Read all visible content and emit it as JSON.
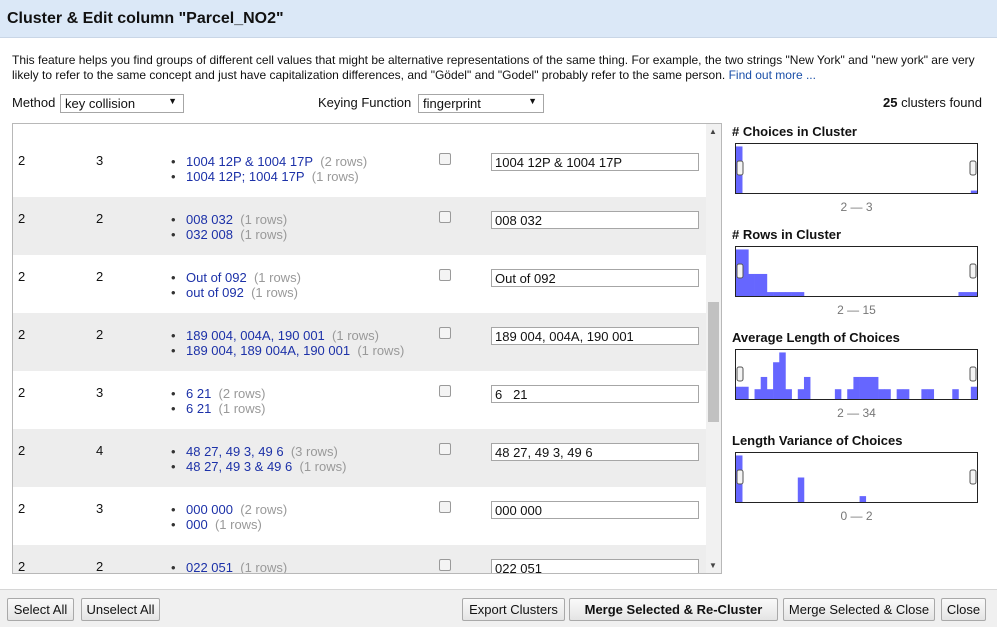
{
  "dialog": {
    "title": "Cluster & Edit column \"Parcel_NO2\"",
    "intro": "This feature helps you find groups of different cell values that might be alternative representations of the same thing. For example, the two strings \"New York\" and \"new york\" are very likely to refer to the same concept and just have capitalization differences, and \"Gödel\" and \"Godel\" probably refer to the same person.",
    "find_out_more": "Find out more ..."
  },
  "controls": {
    "method_label": "Method",
    "method_value": "key collision",
    "keying_label": "Keying Function",
    "keying_value": "fingerprint",
    "clusters_count": "25",
    "clusters_suffix": "clusters found"
  },
  "clusters": [
    {
      "size": "2",
      "rows": "3",
      "choices": [
        {
          "value": "1004 12P & 1004 17P",
          "count": "(2 rows)"
        },
        {
          "value": "1004 12P; 1004 17P",
          "count": "(1 rows)"
        }
      ],
      "new_value": "1004 12P & 1004 17P"
    },
    {
      "size": "2",
      "rows": "2",
      "choices": [
        {
          "value": "008 032",
          "count": "(1 rows)"
        },
        {
          "value": "032 008",
          "count": "(1 rows)"
        }
      ],
      "new_value": "008 032"
    },
    {
      "size": "2",
      "rows": "2",
      "choices": [
        {
          "value": "Out of 092",
          "count": "(1 rows)"
        },
        {
          "value": "out of 092",
          "count": "(1 rows)"
        }
      ],
      "new_value": "Out of 092"
    },
    {
      "size": "2",
      "rows": "2",
      "choices": [
        {
          "value": "189 004, 004A, 190 001",
          "count": "(1 rows)"
        },
        {
          "value": "189 004, 189 004A, 190 001",
          "count": "(1 rows)"
        }
      ],
      "new_value": "189 004, 004A, 190 001"
    },
    {
      "size": "2",
      "rows": "3",
      "choices": [
        {
          "value": "6 21",
          "count": "(2 rows)"
        },
        {
          "value": "6 21",
          "count": "(1 rows)"
        }
      ],
      "new_value": "6   21"
    },
    {
      "size": "2",
      "rows": "4",
      "choices": [
        {
          "value": "48 27, 49 3, 49 6",
          "count": "(3 rows)"
        },
        {
          "value": "48 27, 49 3 & 49 6",
          "count": "(1 rows)"
        }
      ],
      "new_value": "48 27, 49 3, 49 6"
    },
    {
      "size": "2",
      "rows": "3",
      "choices": [
        {
          "value": "000 000",
          "count": "(2 rows)"
        },
        {
          "value": "000",
          "count": "(1 rows)"
        }
      ],
      "new_value": "000 000"
    },
    {
      "size": "2",
      "rows": "2",
      "choices": [
        {
          "value": "022 051",
          "count": "(1 rows)"
        }
      ],
      "new_value": "022 051"
    }
  ],
  "facets": [
    {
      "title": "# Choices in Cluster",
      "range": "2 — 3",
      "bars": [
        0.95,
        0,
        0,
        0,
        0,
        0,
        0,
        0,
        0,
        0,
        0,
        0,
        0,
        0,
        0,
        0,
        0,
        0,
        0,
        0,
        0,
        0,
        0,
        0,
        0,
        0,
        0,
        0,
        0,
        0,
        0,
        0,
        0,
        0,
        0,
        0,
        0,
        0,
        0.05
      ]
    },
    {
      "title": "# Rows in Cluster",
      "range": "2 — 15",
      "bars": [
        0.95,
        0.95,
        0.45,
        0.45,
        0.45,
        0.08,
        0.08,
        0.08,
        0.08,
        0.08,
        0.08,
        0,
        0,
        0,
        0,
        0,
        0,
        0,
        0,
        0,
        0,
        0,
        0,
        0,
        0,
        0,
        0,
        0,
        0,
        0,
        0,
        0,
        0,
        0,
        0,
        0,
        0.08,
        0.08,
        0.08
      ]
    },
    {
      "title": "Average Length of Choices",
      "range": "2 — 34",
      "bars": [
        0.25,
        0.25,
        0,
        0.2,
        0.45,
        0.2,
        0.75,
        0.95,
        0.2,
        0,
        0.2,
        0.45,
        0,
        0,
        0,
        0,
        0.2,
        0,
        0.2,
        0.45,
        0.45,
        0.45,
        0.45,
        0.2,
        0.2,
        0,
        0.2,
        0.2,
        0,
        0,
        0.2,
        0.2,
        0,
        0,
        0,
        0.2,
        0,
        0,
        0.25
      ]
    },
    {
      "title": "Length Variance of Choices",
      "range": "0 — 2",
      "bars": [
        0.95,
        0,
        0,
        0,
        0,
        0,
        0,
        0,
        0,
        0,
        0.5,
        0,
        0,
        0,
        0,
        0,
        0,
        0,
        0,
        0,
        0.12,
        0,
        0,
        0,
        0,
        0,
        0,
        0,
        0,
        0,
        0,
        0,
        0,
        0,
        0,
        0,
        0,
        0,
        0
      ]
    }
  ],
  "buttons": {
    "select_all": "Select All",
    "unselect_all": "Unselect All",
    "export": "Export Clusters",
    "merge_recluster": "Merge Selected & Re-Cluster",
    "merge_close": "Merge Selected & Close",
    "close": "Close"
  },
  "colors": {
    "header_bg": "#dbe8f7",
    "link": "#1a4fa8",
    "choice_value": "#1c31a8",
    "histogram_bar": "#6666ff"
  }
}
